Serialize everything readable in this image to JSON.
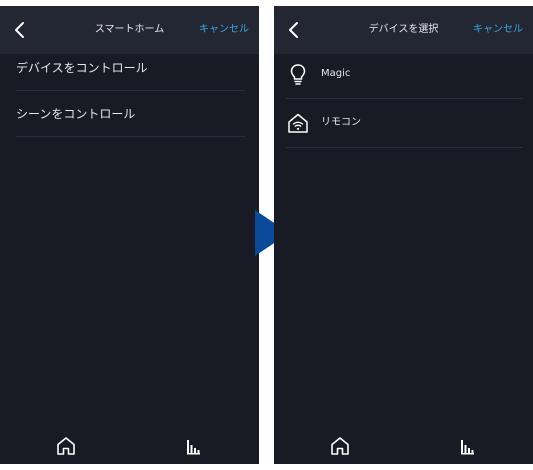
{
  "left_screen": {
    "header": {
      "back_icon": "chevron-left-icon",
      "title": "スマートホーム",
      "cancel_label": "キャンセル"
    },
    "menu_items": [
      {
        "label": "デバイスをコントロール"
      },
      {
        "label": "シーンをコントロール"
      }
    ],
    "tab_bar": [
      {
        "icon": "home-icon"
      },
      {
        "icon": "bars-icon"
      }
    ]
  },
  "right_screen": {
    "header": {
      "back_icon": "chevron-left-icon",
      "title": "デバイスを選択",
      "cancel_label": "キャンセル"
    },
    "devices": [
      {
        "icon": "lightbulb-icon",
        "label": "Magic"
      },
      {
        "icon": "wifi-home-icon",
        "label": "リモコン"
      }
    ],
    "tab_bar": [
      {
        "icon": "home-icon"
      },
      {
        "icon": "bars-icon"
      }
    ]
  },
  "transition_arrow_icon": "arrow-right-triangle-icon",
  "colors": {
    "screen_background": "#181b23",
    "header_background": "#232731",
    "accent": "#3aa8e2",
    "text": "#e6e8ec",
    "divider": "#2b2f39",
    "arrow": "#0b4a9a",
    "page_background": "#ffffff"
  }
}
